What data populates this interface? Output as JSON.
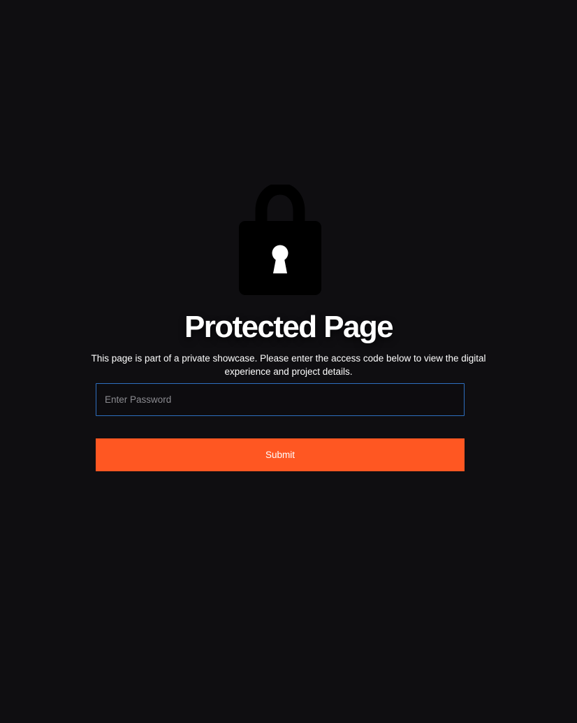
{
  "lock": {
    "icon": "lock-icon",
    "keyhole_icon": "keyhole-icon"
  },
  "heading": "Protected Page",
  "description": "This page is part of a private showcase. Please enter the access code below to view the digital experience and project details.",
  "password": {
    "value": "",
    "placeholder": "Enter Password"
  },
  "submit_label": "Submit",
  "colors": {
    "background": "#0f0e11",
    "accent": "#ff5722",
    "input_border": "#2e6fc0",
    "text": "#ffffff"
  }
}
